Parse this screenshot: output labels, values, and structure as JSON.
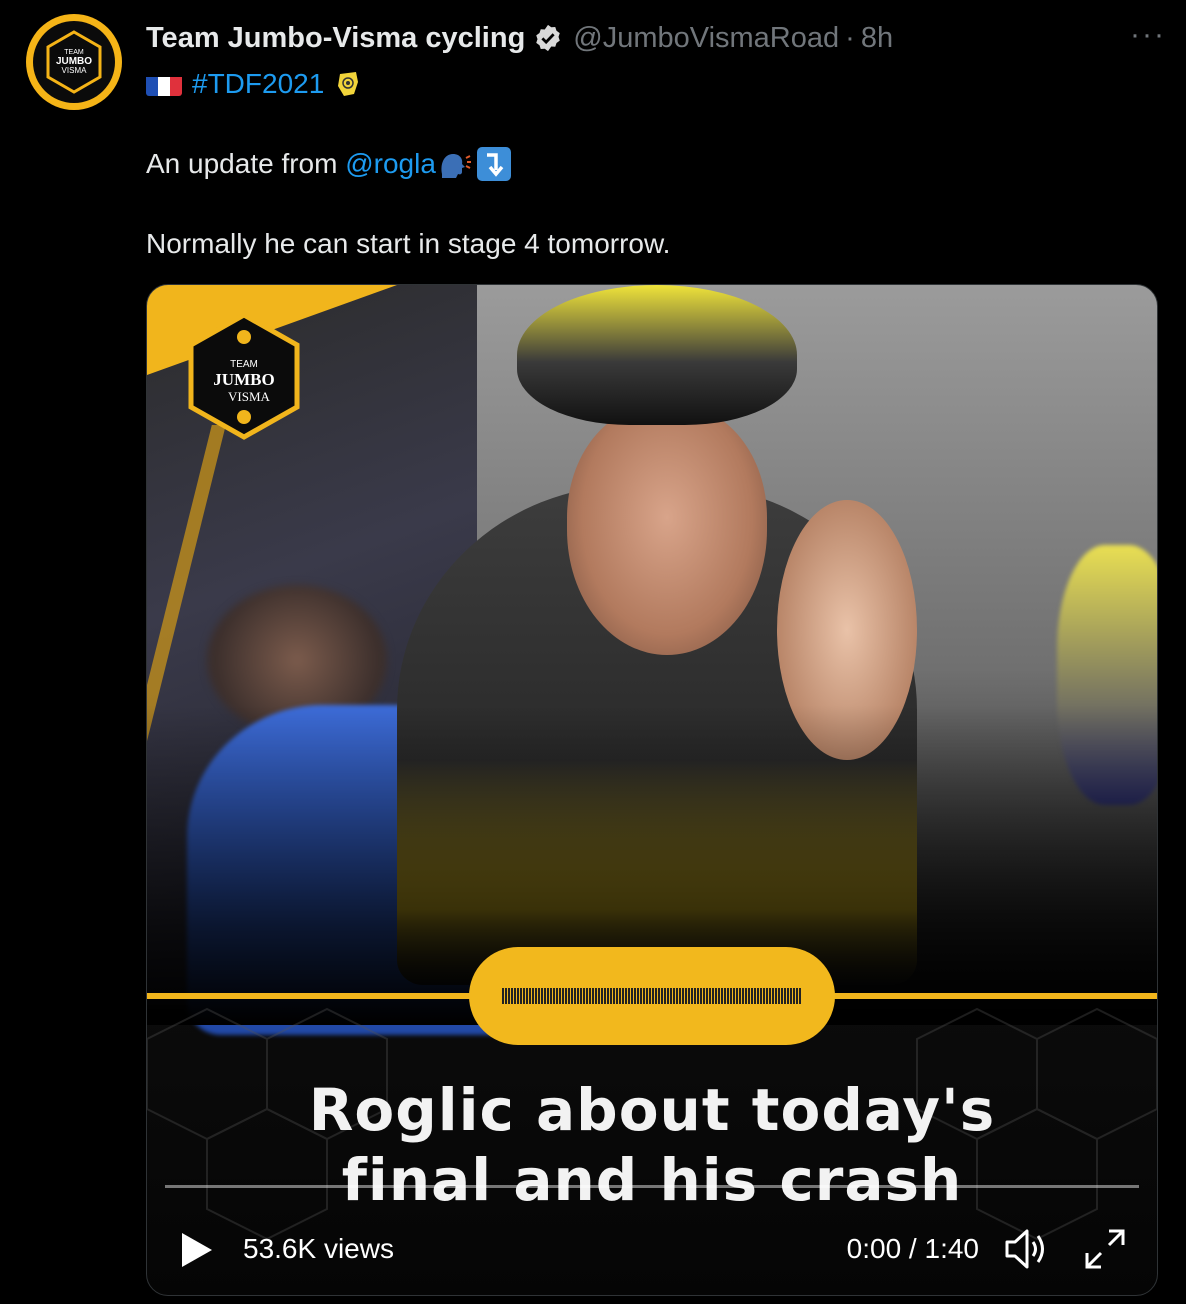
{
  "author": {
    "display_name": "Team Jumbo-Visma cycling",
    "handle": "@JumboVismaRoad",
    "separator": "·",
    "time": "8h",
    "verified": true,
    "avatar_text": [
      "TEAM",
      "JUMBO",
      "VISMA"
    ]
  },
  "more_label": "···",
  "tweet": {
    "hashtag": "#TDF2021",
    "line2_prefix": "An update from ",
    "mention": "@rogla",
    "line3": "Normally he can start in stage 4 tomorrow."
  },
  "media": {
    "logo_text": [
      "TEAM",
      "JUMBO",
      "VISMA"
    ],
    "caption_line1": "Roglic about today's",
    "caption_line2": "final and his crash",
    "views": "53.6K views",
    "current_time": "0:00",
    "time_sep": " / ",
    "duration": "1:40",
    "progress": 0.0
  },
  "colors": {
    "brand_yellow": "#f2b81d",
    "link_blue": "#1d9bf0",
    "muted": "#71767b"
  },
  "icons": [
    "verified-icon",
    "france-flag-icon",
    "tdf-trophy-icon",
    "speaking-head-icon",
    "arrow-down-icon",
    "play-icon",
    "volume-icon",
    "fullscreen-icon",
    "more-icon"
  ]
}
